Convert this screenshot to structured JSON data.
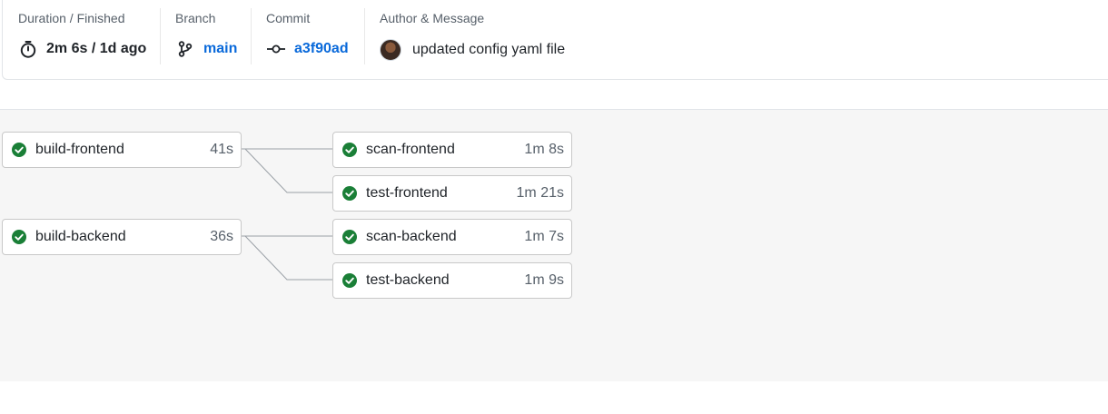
{
  "summary": {
    "duration": {
      "label": "Duration / Finished",
      "value": "2m 6s / 1d ago"
    },
    "branch": {
      "label": "Branch",
      "value": "main"
    },
    "commit": {
      "label": "Commit",
      "value": "a3f90ad"
    },
    "author": {
      "label": "Author & Message",
      "message": "updated config yaml file"
    }
  },
  "colors": {
    "success": "#1a7f37",
    "link": "#0969da"
  },
  "jobs": {
    "build_frontend": {
      "name": "build-frontend",
      "duration": "41s",
      "status": "success"
    },
    "scan_frontend": {
      "name": "scan-frontend",
      "duration": "1m 8s",
      "status": "success"
    },
    "test_frontend": {
      "name": "test-frontend",
      "duration": "1m 21s",
      "status": "success"
    },
    "build_backend": {
      "name": "build-backend",
      "duration": "36s",
      "status": "success"
    },
    "scan_backend": {
      "name": "scan-backend",
      "duration": "1m 7s",
      "status": "success"
    },
    "test_backend": {
      "name": "test-backend",
      "duration": "1m 9s",
      "status": "success"
    }
  }
}
